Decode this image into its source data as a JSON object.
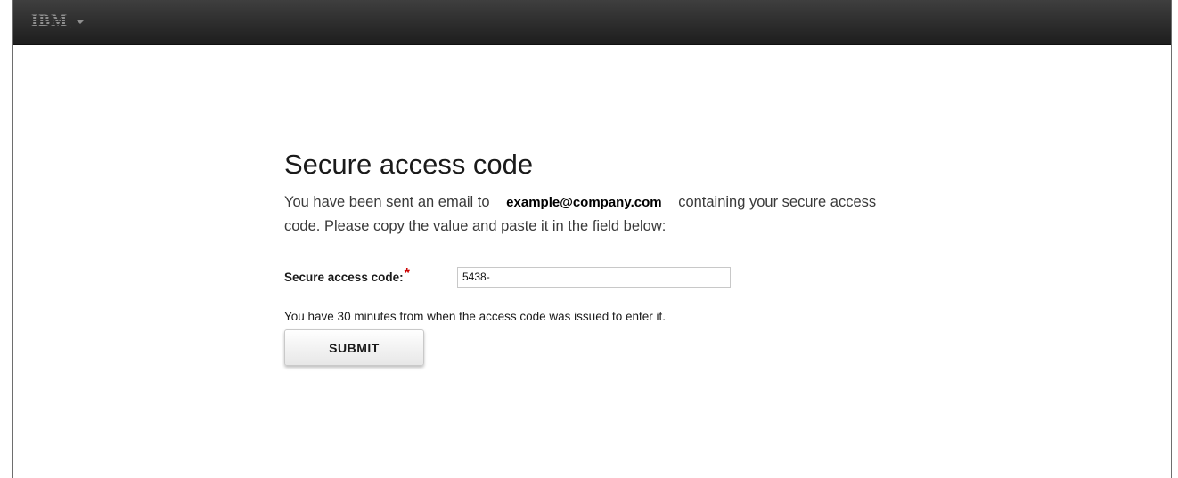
{
  "header": {
    "brand": "IBM",
    "brand_mark": "."
  },
  "main": {
    "title": "Secure access code",
    "intro_before": "You have been sent an email to",
    "email": "example@company.com",
    "intro_after": "containing your secure access code. Please copy the value and paste it in the field below:",
    "field_label": "Secure access code:",
    "required_marker": "*",
    "code_value": "5438-",
    "help_text": "You have 30 minutes from when the access code was issued to enter it.",
    "submit_label": "SUBMIT"
  },
  "colors": {
    "header_background": "#2b2b2b",
    "required_marker": "#cc0000"
  },
  "icons": {
    "brand_menu": "chevron-down-icon"
  }
}
